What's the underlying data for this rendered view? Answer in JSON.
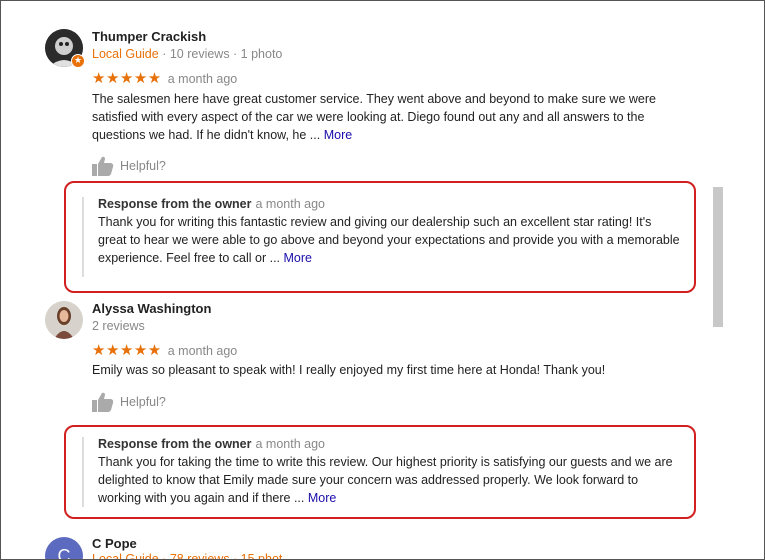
{
  "reviews": [
    {
      "name": "Thumper Crackish",
      "guide": "Local Guide",
      "meta_rest": " · 10 reviews · 1 photo",
      "stars": "★★★★★",
      "date": "a month ago",
      "text": "The salesmen here have great customer service. They went above and beyond to make sure we were satisfied with every aspect of the car we were looking at. Diego found out any and all answers to the questions we had. If he didn't know, he ...",
      "more": "More",
      "helpful": "Helpful?",
      "owner": {
        "title": "Response from the owner",
        "date": "a month ago",
        "text": "Thank you for writing this fantastic review and giving our dealership such an excellent star rating! It's great to hear we were able to go above and beyond your expectations and provide you with a memorable experience. Feel free to call or ...",
        "more": "More"
      }
    },
    {
      "name": "Alyssa Washington",
      "meta": "2 reviews",
      "stars": "★★★★★",
      "date": "a month ago",
      "text": "Emily was so pleasant to speak with! I really enjoyed my first time here at Honda! Thank you!",
      "helpful": "Helpful?",
      "owner": {
        "title": "Response from the owner",
        "date": "a month ago",
        "text": "Thank you for taking the time to write this review. Our highest priority is satisfying our guests and we are delighted to know that Emily made sure your concern was addressed properly. We look forward to working with you again and if there ...",
        "more": "More"
      }
    },
    {
      "name": "C Pope",
      "avatar_letter": "C",
      "meta_partial": "Local Guide · 78 reviews · 15 phot"
    }
  ],
  "colors": {
    "accent_orange": "#e8710a",
    "link_blue": "#1a0dab",
    "highlight_red": "#d21f1f",
    "avatar_purple": "#5c6bc0"
  }
}
